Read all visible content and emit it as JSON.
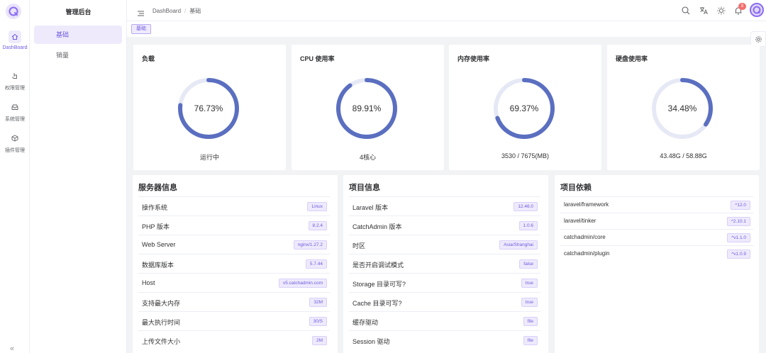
{
  "sidebar": {
    "items": [
      {
        "label": "DashBoard",
        "icon": "home-icon"
      },
      {
        "label": "权限管理",
        "icon": "pointer-icon"
      },
      {
        "label": "系统管理",
        "icon": "inbox-icon"
      },
      {
        "label": "插件管理",
        "icon": "plugin-icon"
      }
    ]
  },
  "subnav": {
    "title": "管理后台",
    "items": [
      {
        "label": "基础"
      },
      {
        "label": "销量"
      }
    ]
  },
  "header": {
    "breadcrumb": [
      "DashBoard",
      "基础"
    ],
    "breadcrumb_sep": "/",
    "notification_count": "8"
  },
  "tags": {
    "active": "基础"
  },
  "stats": [
    {
      "title": "负载",
      "value": "76.73%",
      "percent": 76.73,
      "sub": "运行中"
    },
    {
      "title": "CPU 使用率",
      "value": "89.91%",
      "percent": 89.91,
      "sub": "4核心"
    },
    {
      "title": "内存使用率",
      "value": "69.37%",
      "percent": 69.37,
      "sub": "3530 / 7675(MB)"
    },
    {
      "title": "硬盘使用率",
      "value": "34.48%",
      "percent": 34.48,
      "sub": "43.48G / 58.88G"
    }
  ],
  "server_info": {
    "title": "服务器信息",
    "rows": [
      {
        "k": "操作系统",
        "v": "Linux"
      },
      {
        "k": "PHP 版本",
        "v": "8.2.4"
      },
      {
        "k": "Web Server",
        "v": "nginx/1.27.2"
      },
      {
        "k": "数据库版本",
        "v": "5.7.44"
      },
      {
        "k": "Host",
        "v": "v5.catchadmin.com"
      },
      {
        "k": "支持最大内存",
        "v": "32M"
      },
      {
        "k": "最大执行时间",
        "v": "30/S"
      },
      {
        "k": "上传文件大小",
        "v": "2M"
      }
    ]
  },
  "project_info": {
    "title": "项目信息",
    "rows": [
      {
        "k": "Laravel 版本",
        "v": "12.46.0"
      },
      {
        "k": "CatchAdmin 版本",
        "v": "1.0.6"
      },
      {
        "k": "时区",
        "v": "Asia/Shanghai"
      },
      {
        "k": "是否开启调试模式",
        "v": "false"
      },
      {
        "k": "Storage 目录可写?",
        "v": "true"
      },
      {
        "k": "Cache 目录可写?",
        "v": "true"
      },
      {
        "k": "缓存驱动",
        "v": "file"
      },
      {
        "k": "Session 驱动",
        "v": "file"
      }
    ]
  },
  "dependencies": {
    "title": "项目依赖",
    "rows": [
      {
        "k": "laravel/framework",
        "v": "^12.0"
      },
      {
        "k": "laravel/tinker",
        "v": "^2.10.1"
      },
      {
        "k": "catchadmin/core",
        "v": "^v1.1.0"
      },
      {
        "k": "catchadmin/plugin",
        "v": "^v1.0.9"
      }
    ]
  },
  "colors": {
    "accent": "#6f5be0",
    "gauge": "#5b6fc0",
    "gauge_track": "#e6e9f5"
  }
}
